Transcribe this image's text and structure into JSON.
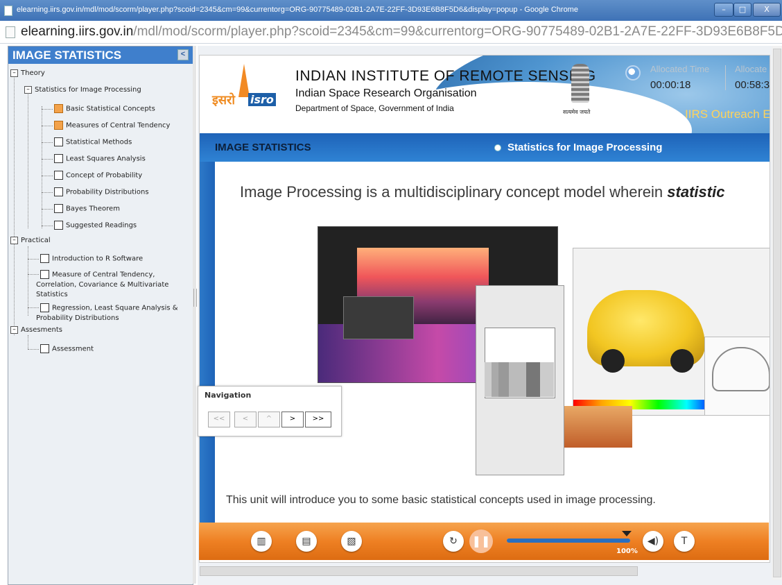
{
  "window": {
    "title": "elearning.iirs.gov.in/mdl/mod/scorm/player.php?scoid=2345&cm=99&currentorg=ORG-90775489-02B1-2A7E-22FF-3D93E6B8F5D6&display=popup - Google Chrome",
    "controls": {
      "minimize": "–",
      "maximize": "□",
      "close": "X"
    }
  },
  "address": {
    "host": "elearning.iirs.gov.in",
    "path": "/mdl/mod/scorm/player.php?scoid=2345&cm=99&currentorg=ORG-90775489-02B1-2A7E-22FF-3D93E6B8F5D6&displa"
  },
  "toc": {
    "title": "IMAGE STATISTICS",
    "collapse": "<",
    "sections": {
      "theory": "Theory",
      "stats": "Statistics for Image Processing",
      "practical": "Practical",
      "assessments": "Assesments"
    },
    "theory_items": [
      {
        "label": "Basic Statistical Concepts",
        "done": true
      },
      {
        "label": "Measures of Central Tendency",
        "done": true
      },
      {
        "label": "Statistical Methods",
        "done": false
      },
      {
        "label": "Least Squares Analysis",
        "done": false
      },
      {
        "label": "Concept of Probability",
        "done": false
      },
      {
        "label": "Probability Distributions",
        "done": false
      },
      {
        "label": "Bayes Theorem",
        "done": false
      },
      {
        "label": "Suggested Readings",
        "done": false
      }
    ],
    "practical_items": [
      "Introduction to R Software",
      "Measure of Central Tendency, Correlation, Covariance & Multivariate Statistics",
      "Regression, Least Square Analysis & Probability Distributions"
    ],
    "assessment_items": [
      "Assessment"
    ]
  },
  "banner": {
    "logo_hindi": "इसरो",
    "logo_english": "isro",
    "org_line1": "INDIAN INSTITUTE OF REMOTE SENSING",
    "org_line2": "Indian Space Research Organisation",
    "org_line3": "Department of Space, Government of India",
    "motto": "सत्यमेव जयते",
    "allocated_time_label": "Allocated Time",
    "allocated_time_value": "00:00:18",
    "allocated_label2": "Allocate",
    "allocated_value2": "00:58:3",
    "outreach": "IIRS Outreach E"
  },
  "section": {
    "title": "IMAGE STATISTICS",
    "subtitle": "Statistics for Image Processing"
  },
  "content": {
    "headline_plain": "Image Processing is a multidisciplinary concept model wherein ",
    "headline_emph": "statistic",
    "subtext": "This unit will introduce you to some basic statistical concepts used in image processing."
  },
  "navigation": {
    "label": "Navigation",
    "buttons": [
      "<<",
      "<",
      "^",
      ">",
      ">>"
    ],
    "enabled": [
      false,
      false,
      false,
      true,
      true
    ]
  },
  "controls": {
    "icons": [
      "book-icon",
      "notes-icon",
      "document-icon",
      "replay-icon",
      "pause-icon",
      "volume-icon",
      "text-size-icon"
    ],
    "progress_percent": "100%",
    "progress_fraction": 1.0,
    "colors": {
      "bar": "#ee8023",
      "progress": "#2a6fbf"
    }
  }
}
